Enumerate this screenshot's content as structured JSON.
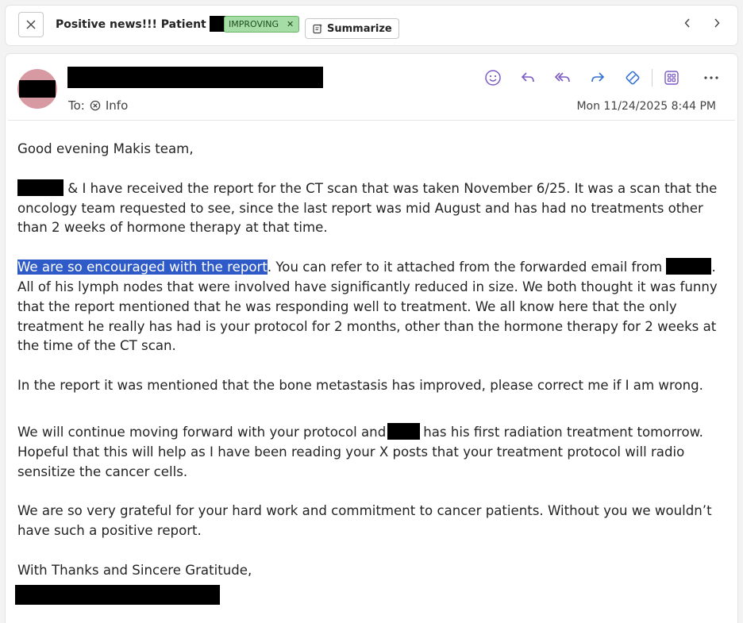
{
  "header": {
    "subject": "Positive news!!! Patient",
    "tag": {
      "label": "IMPROVING",
      "color": "#a6dca6"
    },
    "summarize_label": "Summarize",
    "icons": [
      "close-icon",
      "summarize-icon",
      "chevron-left-icon",
      "chevron-right-icon"
    ]
  },
  "email": {
    "to_label": "To:",
    "recipient": "Info",
    "date": "Mon 11/24/2025 8:44 PM",
    "actions": [
      "emoji-icon",
      "reply-icon",
      "reply-all-icon",
      "forward-icon",
      "sticker-icon",
      "apps-icon",
      "more-icon"
    ],
    "body": {
      "greeting": "Good evening Makis team,",
      "p1": "& I have received the report for the CT scan that was taken November 6/25. It was a scan that the oncology team requested to see, since the last report was mid August and has had no treatments other than 2 weeks of hormone therapy at that time.",
      "p2_highlight": "We are so encouraged with the report",
      "p2_a": ". You can refer to it attached from the forwarded email from",
      "p2_b": ". All of his lymph nodes that were involved have significantly reduced in size. We both thought it was funny that the report mentioned that he was responding well to treatment. We all know here that the only treatment he really has had is your protocol for 2 months,  other than the hormone therapy for 2 weeks at the time of the CT scan.",
      "p3": "In the report it was mentioned that the bone metastasis has improved, please correct me if I am wrong.",
      "p4_a": "We will continue moving forward with your protocol and",
      "p4_b": "has his first radiation treatment tomorrow. Hopeful that this will help as I have been reading your X posts that  your treatment protocol will radio sensitize the cancer cells.",
      "p5": "We are so very grateful for your hard work and commitment to cancer patients. Without you we wouldn’t have such a positive report.",
      "closing": "With Thanks and Sincere Gratitude,"
    }
  },
  "colors": {
    "highlight": "#2e5bc8",
    "accent": "#7b5ac7",
    "blue_icon": "#2f6fd6"
  }
}
